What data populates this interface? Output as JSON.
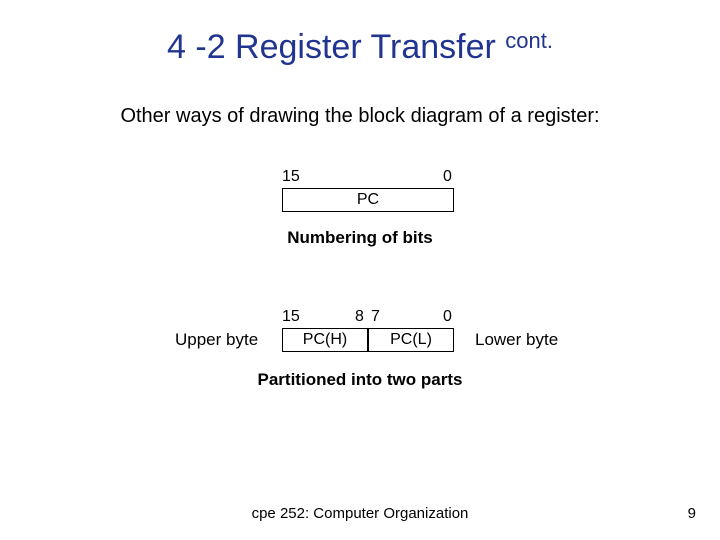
{
  "title": {
    "main": "4 -2 Register Transfer ",
    "sup": "cont."
  },
  "subtitle": "Other ways of drawing the block diagram of a register:",
  "fig1": {
    "left_bit": "15",
    "right_bit": "0",
    "label": "PC",
    "caption": "Numbering of bits"
  },
  "fig2": {
    "b15": "15",
    "b8": "8",
    "b7": "7",
    "b0": "0",
    "high": "PC(H)",
    "low": "PC(L)",
    "left_label": "Upper byte",
    "right_label": "Lower byte",
    "caption": "Partitioned into two parts"
  },
  "footer": "cpe 252: Computer Organization",
  "page": "9"
}
